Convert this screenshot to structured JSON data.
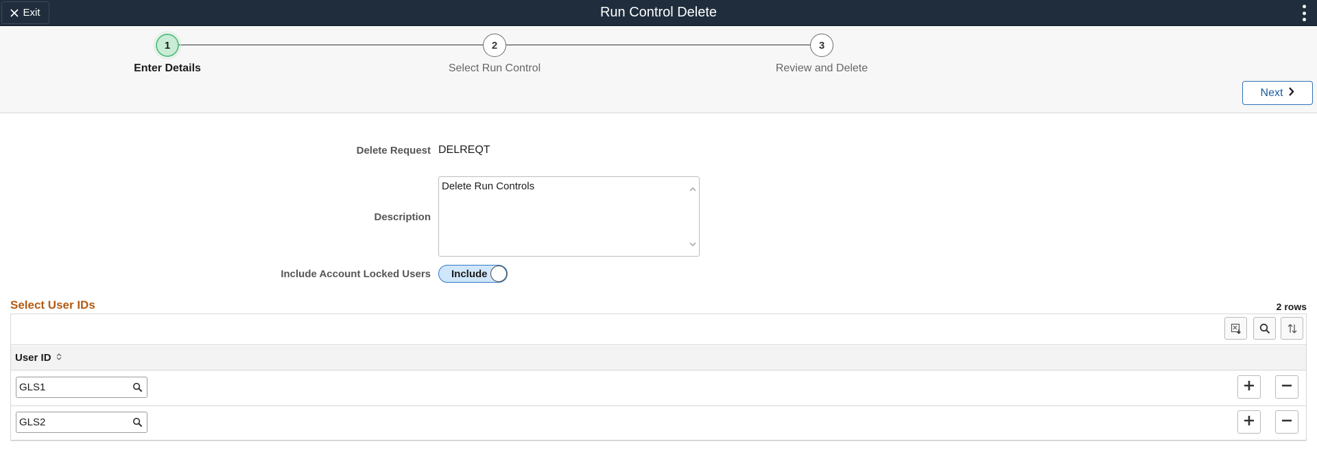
{
  "header": {
    "exit_label": "Exit",
    "title": "Run Control Delete"
  },
  "train": {
    "steps": [
      {
        "number": "1",
        "label": "Enter Details",
        "active": true
      },
      {
        "number": "2",
        "label": "Select Run Control",
        "active": false
      },
      {
        "number": "3",
        "label": "Review and Delete",
        "active": false
      }
    ],
    "next_label": "Next"
  },
  "form": {
    "delete_request_label": "Delete Request",
    "delete_request_value": "DELREQT",
    "description_label": "Description",
    "description_value": "Delete Run Controls",
    "include_locked_label": "Include Account Locked Users",
    "include_locked_toggle": "Include"
  },
  "grid": {
    "title": "Select User IDs",
    "row_count": "2 rows",
    "column_header": "User ID",
    "rows": [
      {
        "user_id": "GLS1"
      },
      {
        "user_id": "GLS2"
      }
    ]
  },
  "colors": {
    "header_bg": "#1f2d3d",
    "accent_blue": "#2d6fb3",
    "grid_title": "#b35a13",
    "active_step": "#c8ecd6"
  }
}
